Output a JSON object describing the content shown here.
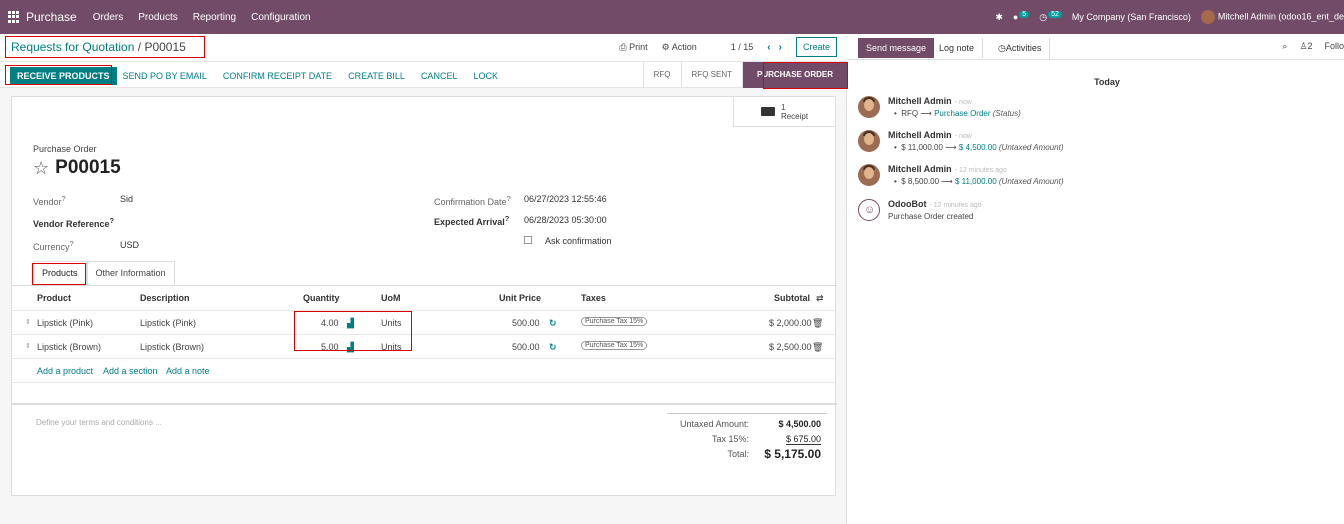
{
  "topbar": {
    "app_name": "Purchase",
    "menu": [
      "Orders",
      "Products",
      "Reporting",
      "Configuration"
    ],
    "messages_count": "5",
    "activities_count": "52",
    "company": "My Company (San Francisco)",
    "user": "Mitchell Admin (odoo16_ent_de"
  },
  "control_panel": {
    "breadcrumb_parent": "Requests for Quotation",
    "breadcrumb_sep": "/",
    "breadcrumb_current": "P00015",
    "print": "Print",
    "action": "Action",
    "pager": "1 / 15",
    "create": "Create"
  },
  "statusbar": {
    "buttons": [
      "RECEIVE PRODUCTS",
      "SEND PO BY EMAIL",
      "CONFIRM RECEIPT DATE",
      "CREATE BILL",
      "CANCEL",
      "LOCK"
    ],
    "stages": [
      "RFQ",
      "RFQ SENT",
      "PURCHASE ORDER"
    ]
  },
  "smart_button": {
    "count": "1",
    "label": "Receipt"
  },
  "form": {
    "doc_type": "Purchase Order",
    "name": "P00015",
    "vendor_label": "Vendor",
    "vendor": "Sid",
    "vendor_ref_label": "Vendor Reference",
    "currency_label": "Currency",
    "currency": "USD",
    "confirmation_date_label": "Confirmation Date",
    "confirmation_date": "06/27/2023 12:55:46",
    "expected_arrival_label": "Expected Arrival",
    "expected_arrival": "06/28/2023 05:30:00",
    "ask_confirmation": "Ask confirmation",
    "tooltip_mark": "?"
  },
  "tabs": [
    "Products",
    "Other Information"
  ],
  "table": {
    "headers": [
      "Product",
      "Description",
      "Quantity",
      "UoM",
      "Unit Price",
      "Taxes",
      "Subtotal"
    ],
    "rows": [
      {
        "product": "Lipstick (Pink)",
        "description": "Lipstick (Pink)",
        "qty": "4.00",
        "uom": "Units",
        "price": "500.00",
        "tax": "Purchase Tax 15%",
        "subtotal": "$ 2,000.00"
      },
      {
        "product": "Lipstick (Brown)",
        "description": "Lipstick (Brown)",
        "qty": "5.00",
        "uom": "Units",
        "price": "500.00",
        "tax": "Purchase Tax 15%",
        "subtotal": "$ 2,500.00"
      }
    ],
    "add_product": "Add a product",
    "add_section": "Add a section",
    "add_note": "Add a note"
  },
  "terms_placeholder": "Define your terms and conditions ...",
  "totals": {
    "untaxed_label": "Untaxed Amount:",
    "untaxed": "$ 4,500.00",
    "tax_label": "Tax 15%:",
    "tax": "$ 675.00",
    "total_label": "Total:",
    "total": "$ 5,175.00"
  },
  "chatter": {
    "send_message": "Send message",
    "log_note": "Log note",
    "activities": "Activities",
    "followers_count": "2",
    "follow": "Follo",
    "today": "Today",
    "messages": [
      {
        "author": "Mitchell Admin",
        "time": "- now",
        "old": "RFQ",
        "new": "Purchase Order",
        "field": "(Status)"
      },
      {
        "author": "Mitchell Admin",
        "time": "- now",
        "old": "$ 11,000.00",
        "new": "$ 4,500.00",
        "field": "(Untaxed Amount)"
      },
      {
        "author": "Mitchell Admin",
        "time": "- 12 minutes ago",
        "old": "$ 8,500.00",
        "new": "$ 11,000.00",
        "field": "(Untaxed Amount)"
      }
    ],
    "bot": {
      "author": "OdooBot",
      "time": "- 12 minutes ago",
      "text": "Purchase Order created"
    }
  }
}
